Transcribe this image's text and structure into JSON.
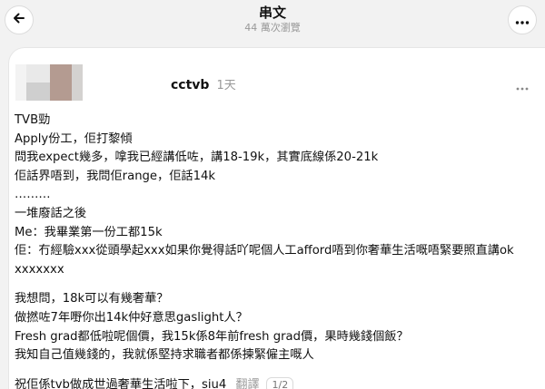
{
  "header": {
    "title": "串文",
    "subtitle": "44 萬次瀏覽"
  },
  "icons": {
    "back": "arrow-left-icon",
    "more": "more-horizontal-icon",
    "post_more": "more-horizontal-icon"
  },
  "post": {
    "username": "cctvb",
    "time": "1天",
    "lines": [
      "TVB勁",
      "Apply份工，佢打黎傾",
      "問我expect幾多，嗱我已經講低咗，講18-19k，其實底線係20-21k",
      "佢話界唔到，我問佢range，佢話14k",
      "………",
      "一堆廢話之後",
      "Me：我畢業第一份工都15k",
      "佢：冇經驗xxx從頭學起xxx如果你覺得話吖呢個人工afford唔到你奢華生活嘅唔緊要照直講ok xxxxxxx"
    ],
    "lines2": [
      "我想問，18k可以有幾奢華？",
      "做撚咗7年嘢你出14k仲好意思gaslight人？",
      "Fresh grad都低啦呢個價，我15k係8年前fresh grad價，果時幾錢個飯？",
      "我知自己值幾錢的，我就係堅持求職者都係揀緊僱主嘅人"
    ],
    "last_line": "祝佢係tvb做成世過奢華生活啦下，siu4",
    "translate_label": "翻譯",
    "pager": "1/2"
  }
}
